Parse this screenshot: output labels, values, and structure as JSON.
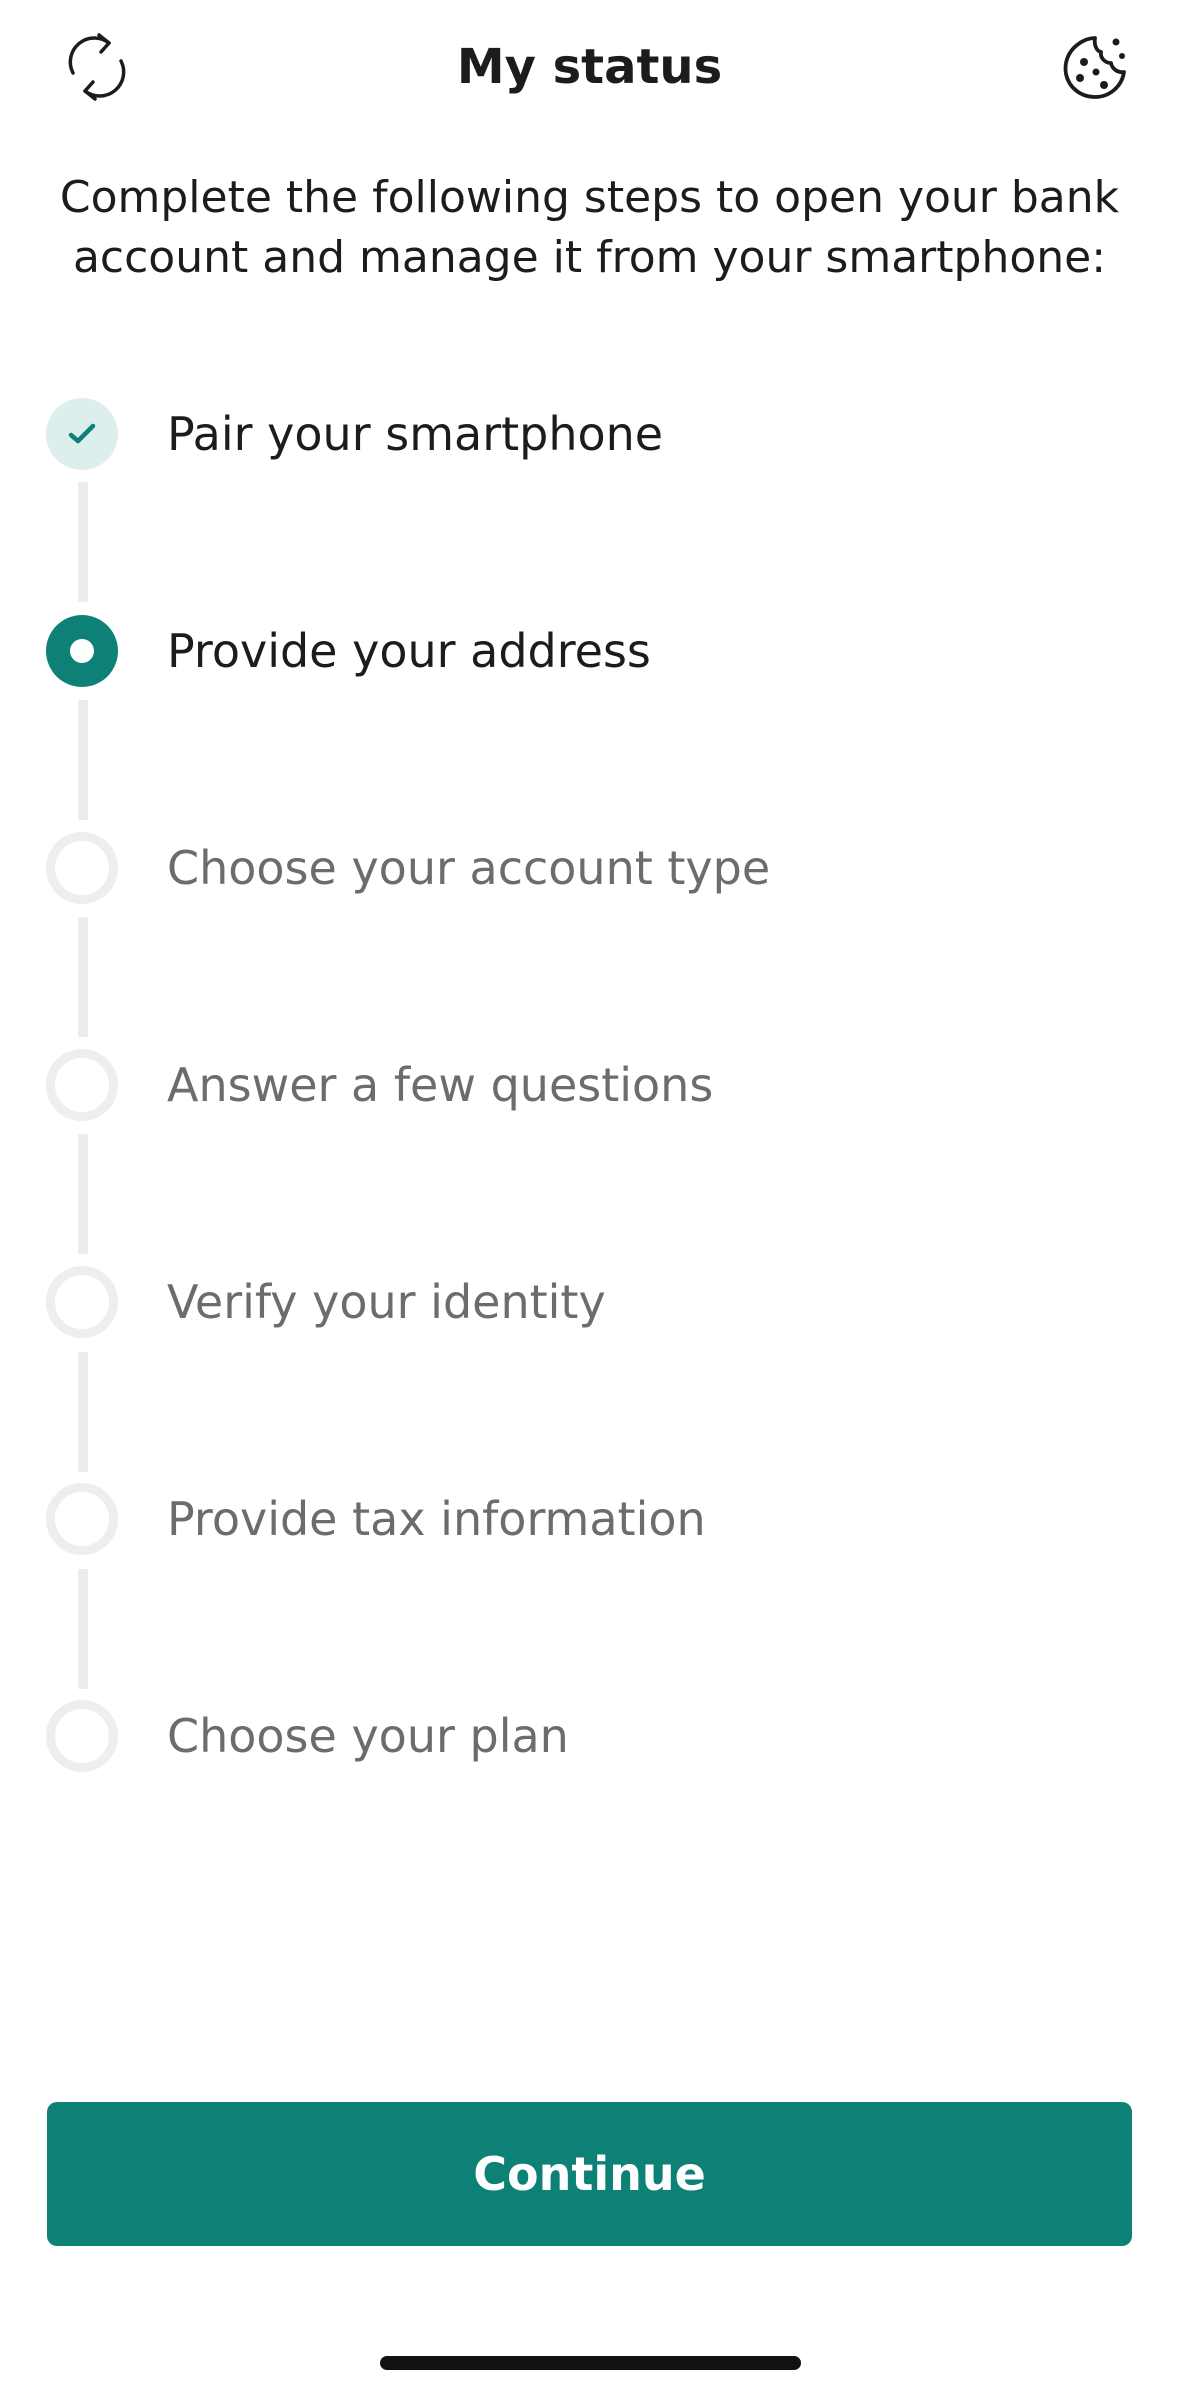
{
  "header": {
    "title": "My status",
    "left_icon": "refresh-icon",
    "right_icon": "cookie-icon"
  },
  "intro": {
    "text": "Complete the following steps to open your bank account and manage it from your smartphone:"
  },
  "steps": [
    {
      "label": "Pair your smartphone",
      "state": "done"
    },
    {
      "label": "Provide your address",
      "state": "current"
    },
    {
      "label": "Choose your account type",
      "state": "pending"
    },
    {
      "label": "Answer a few questions",
      "state": "pending"
    },
    {
      "label": "Verify your identity",
      "state": "pending"
    },
    {
      "label": "Provide tax information",
      "state": "pending"
    },
    {
      "label": "Choose your plan",
      "state": "pending"
    }
  ],
  "actions": {
    "continue_label": "Continue"
  },
  "colors": {
    "accent": "#0e8177",
    "done_bg": "#dcefed",
    "pending_ring": "#eeeeee",
    "muted_text": "#6c6c6c"
  }
}
